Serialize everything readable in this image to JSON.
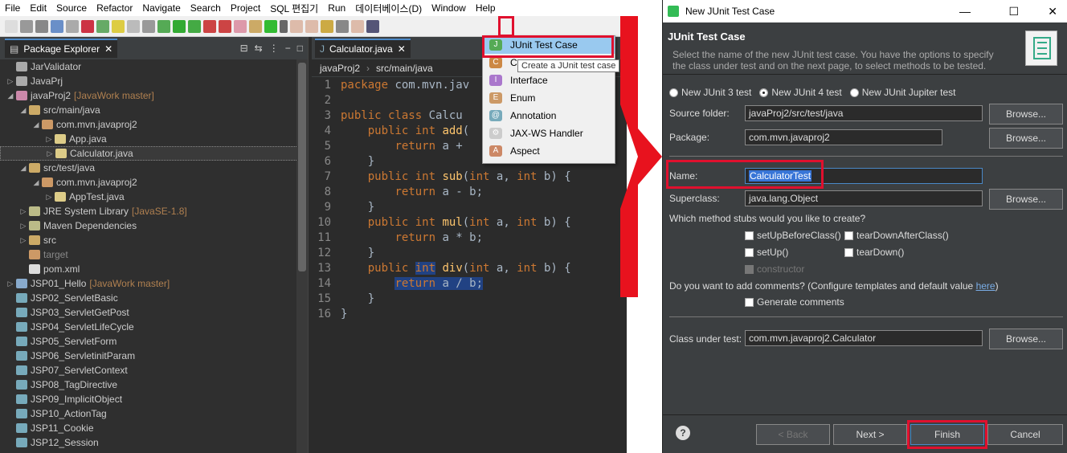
{
  "menu": [
    "File",
    "Edit",
    "Source",
    "Refactor",
    "Navigate",
    "Search",
    "Project",
    "SQL 편집기",
    "Run",
    "데이터베이스(D)",
    "Window",
    "Help"
  ],
  "explorer": {
    "tab": "Package Explorer",
    "items": [
      {
        "label": "JarValidator",
        "git": ""
      },
      {
        "label": "JavaPrj",
        "git": ""
      },
      {
        "label": "javaProj2",
        "git": "[JavaWork master]"
      },
      {
        "label": "src/main/java",
        "git": ""
      },
      {
        "label": "com.mvn.javaproj2",
        "git": ""
      },
      {
        "label": "App.java",
        "git": ""
      },
      {
        "label": "Calculator.java",
        "git": ""
      },
      {
        "label": "src/test/java",
        "git": ""
      },
      {
        "label": "com.mvn.javaproj2",
        "git": ""
      },
      {
        "label": "AppTest.java",
        "git": ""
      },
      {
        "label": "JRE System Library",
        "git": "[JavaSE-1.8]"
      },
      {
        "label": "Maven Dependencies",
        "git": ""
      },
      {
        "label": "src",
        "git": ""
      },
      {
        "label": "target",
        "git": ""
      },
      {
        "label": "pom.xml",
        "git": ""
      },
      {
        "label": "JSP01_Hello",
        "git": "[JavaWork master]"
      },
      {
        "label": "JSP02_ServletBasic",
        "git": ""
      },
      {
        "label": "JSP03_ServletGetPost",
        "git": ""
      },
      {
        "label": "JSP04_ServletLifeCycle",
        "git": ""
      },
      {
        "label": "JSP05_ServletForm",
        "git": ""
      },
      {
        "label": "JSP06_ServletinitParam",
        "git": ""
      },
      {
        "label": "JSP07_ServletContext",
        "git": ""
      },
      {
        "label": "JSP08_TagDirective",
        "git": ""
      },
      {
        "label": "JSP09_ImplicitObject",
        "git": ""
      },
      {
        "label": "JSP10_ActionTag",
        "git": ""
      },
      {
        "label": "JSP11_Cookie",
        "git": ""
      },
      {
        "label": "JSP12_Session",
        "git": ""
      }
    ]
  },
  "editor": {
    "tab": "Calculator.java",
    "crumbs": [
      "javaProj2",
      "src/main/java"
    ],
    "lines": [
      "1",
      "2",
      "3",
      "4",
      "5",
      "6",
      "7",
      "8",
      "9",
      "10",
      "11",
      "12",
      "13",
      "14",
      "15",
      "16"
    ]
  },
  "dropdown": {
    "items": [
      "JUnit Test Case",
      "C",
      "Interface",
      "Enum",
      "Annotation",
      "JAX-WS Handler",
      "Aspect"
    ],
    "tooltip": "Create a JUnit test case"
  },
  "dialog": {
    "window_title": "New JUnit Test Case",
    "heading": "JUnit Test Case",
    "description": "Select the name of the new JUnit test case. You have the options to specify the class under test and on the next page, to select methods to be tested.",
    "radio_junit3": "New JUnit 3 test",
    "radio_junit4": "New JUnit 4 test",
    "radio_jupiter": "New JUnit Jupiter test",
    "source_folder_label": "Source folder:",
    "source_folder": "javaProj2/src/test/java",
    "package_label": "Package:",
    "package": "com.mvn.javaproj2",
    "name_label": "Name:",
    "name": "CalculatorTest",
    "superclass_label": "Superclass:",
    "superclass": "java.lang.Object",
    "browse": "Browse...",
    "stubs_question": "Which method stubs would you like to create?",
    "stub_setUpBeforeClass": "setUpBeforeClass()",
    "stub_tearDownAfterClass": "tearDownAfterClass()",
    "stub_setUp": "setUp()",
    "stub_tearDown": "tearDown()",
    "stub_constructor": "constructor",
    "comments_question": "Do you want to add comments? (Configure templates and default value",
    "comments_link": "here",
    "generate_comments": "Generate comments",
    "class_under_test_label": "Class under test:",
    "class_under_test": "com.mvn.javaproj2.Calculator",
    "back": "< Back",
    "next": "Next >",
    "finish": "Finish",
    "cancel": "Cancel",
    "help": "?"
  },
  "colors": {
    "highlight": "#e0102e",
    "accent": "#4a88c7"
  }
}
